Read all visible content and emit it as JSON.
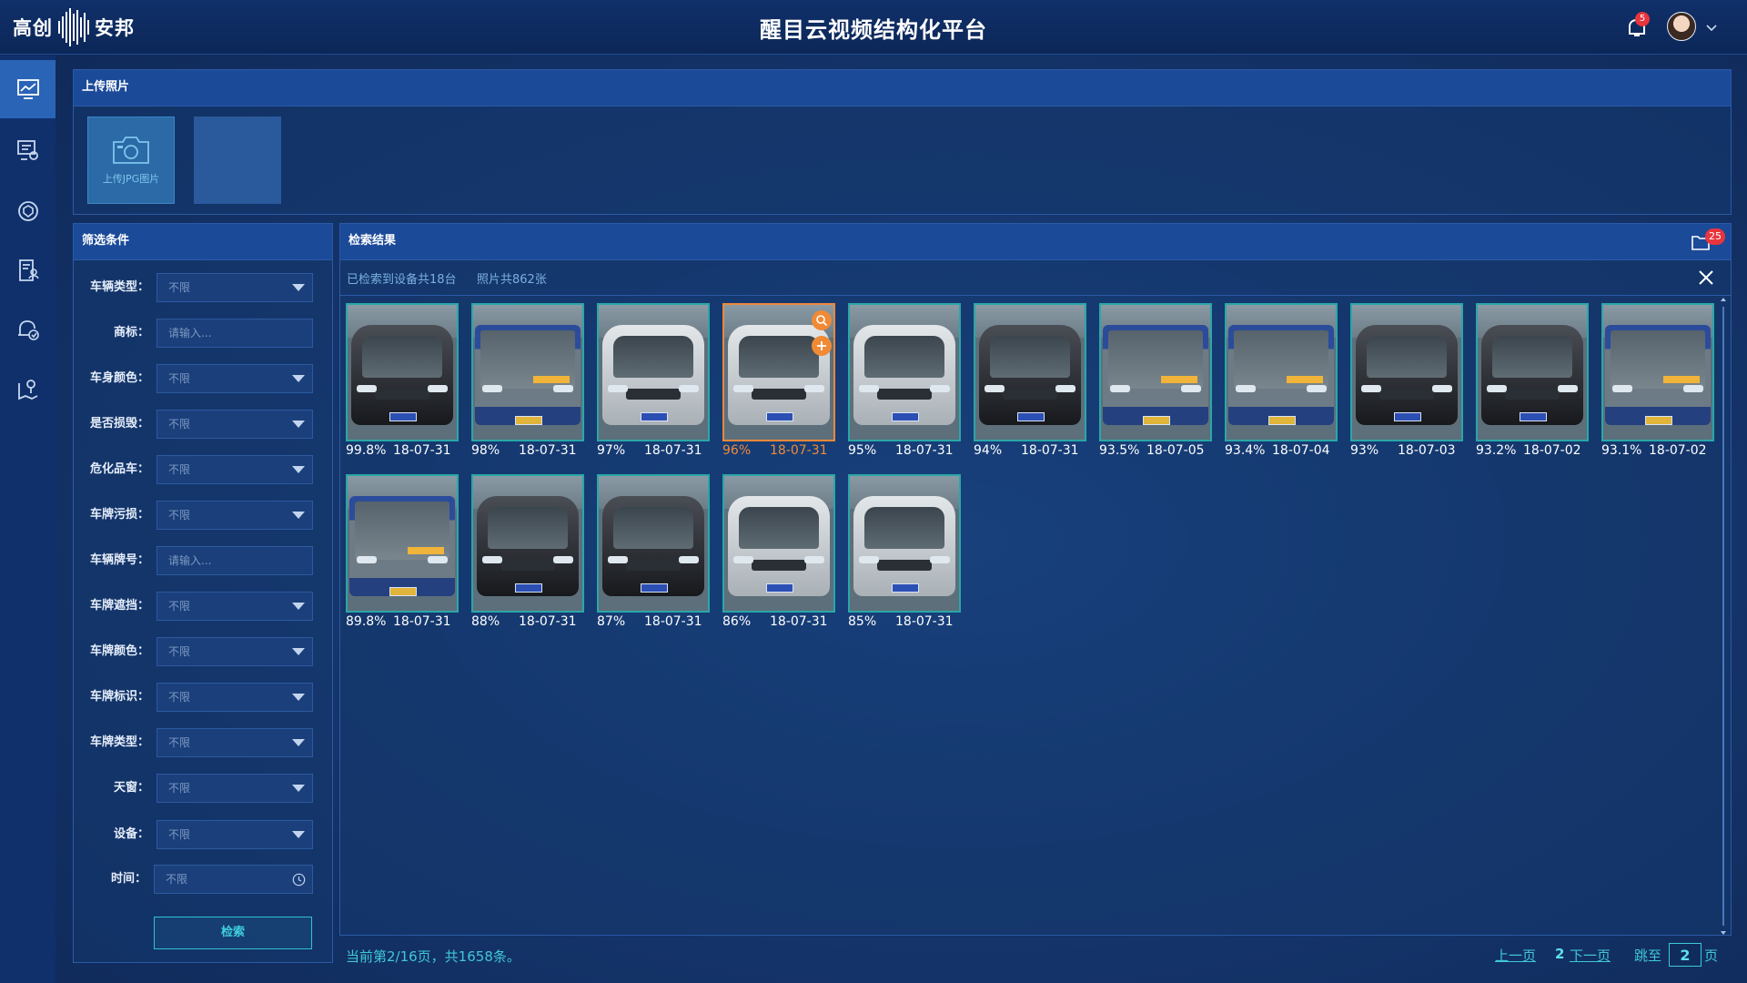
{
  "header": {
    "logo_left": "高创",
    "logo_right": "安邦",
    "title": "醒目云视频结构化平台",
    "notification_count": "5"
  },
  "rail": {
    "items": [
      "monitor-chart-icon",
      "list-settings-icon",
      "target-shield-icon",
      "document-user-icon",
      "alarm-check-icon",
      "map-pin-icon"
    ],
    "active_index": 0
  },
  "upload": {
    "panel_title": "上传照片",
    "button_label": "上传JPG图片"
  },
  "filters": {
    "panel_title": "筛选条件",
    "fields": [
      {
        "label": "车辆类型：",
        "value": "不限",
        "kind": "select"
      },
      {
        "label": "商标：",
        "placeholder": "请输入...",
        "kind": "input"
      },
      {
        "label": "车身颜色：",
        "value": "不限",
        "kind": "select"
      },
      {
        "label": "是否损毁：",
        "value": "不限",
        "kind": "select"
      },
      {
        "label": "危化品车：",
        "value": "不限",
        "kind": "select"
      },
      {
        "label": "车牌污损：",
        "value": "不限",
        "kind": "select"
      },
      {
        "label": "车辆牌号：",
        "placeholder": "请输入...",
        "kind": "input"
      },
      {
        "label": "车牌遮挡：",
        "value": "不限",
        "kind": "select"
      },
      {
        "label": "车牌颜色：",
        "value": "不限",
        "kind": "select"
      },
      {
        "label": "车牌标识：",
        "value": "不限",
        "kind": "select"
      },
      {
        "label": "车牌类型：",
        "value": "不限",
        "kind": "select"
      },
      {
        "label": "天窗：",
        "value": "不限",
        "kind": "select"
      },
      {
        "label": "设备：",
        "value": "不限",
        "kind": "select"
      },
      {
        "label": "时间：",
        "value": "不限",
        "kind": "time"
      }
    ],
    "search_button": "检索"
  },
  "results": {
    "panel_title": "检索结果",
    "folder_count": "25",
    "devices_text": "已检索到设备共18台",
    "photos_text": "照片共862张",
    "items": [
      {
        "pct": "99.8%",
        "date": "18-07-31",
        "kind": "black"
      },
      {
        "pct": "98%",
        "date": "18-07-31",
        "kind": "bus"
      },
      {
        "pct": "97%",
        "date": "18-07-31",
        "kind": "silver"
      },
      {
        "pct": "96%",
        "date": "18-07-31",
        "kind": "silver",
        "selected": true
      },
      {
        "pct": "95%",
        "date": "18-07-31",
        "kind": "silver"
      },
      {
        "pct": "94%",
        "date": "18-07-31",
        "kind": "black"
      },
      {
        "pct": "93.5%",
        "date": "18-07-05",
        "kind": "bus"
      },
      {
        "pct": "93.4%",
        "date": "18-07-04",
        "kind": "bus"
      },
      {
        "pct": "93%",
        "date": "18-07-03",
        "kind": "black"
      },
      {
        "pct": "93.2%",
        "date": "18-07-02",
        "kind": "black"
      },
      {
        "pct": "93.1%",
        "date": "18-07-02",
        "kind": "bus"
      },
      {
        "pct": "89.8%",
        "date": "18-07-31",
        "kind": "bus"
      },
      {
        "pct": "88%",
        "date": "18-07-31",
        "kind": "black"
      },
      {
        "pct": "87%",
        "date": "18-07-31",
        "kind": "black"
      },
      {
        "pct": "86%",
        "date": "18-07-31",
        "kind": "silver"
      },
      {
        "pct": "85%",
        "date": "18-07-31",
        "kind": "silver"
      }
    ]
  },
  "footer": {
    "page_info": "当前第2/16页，共1658条。",
    "prev": "上一页",
    "current": "2",
    "next": "下一页",
    "goto": "跳至",
    "goto_value": "2",
    "unit": "页"
  }
}
